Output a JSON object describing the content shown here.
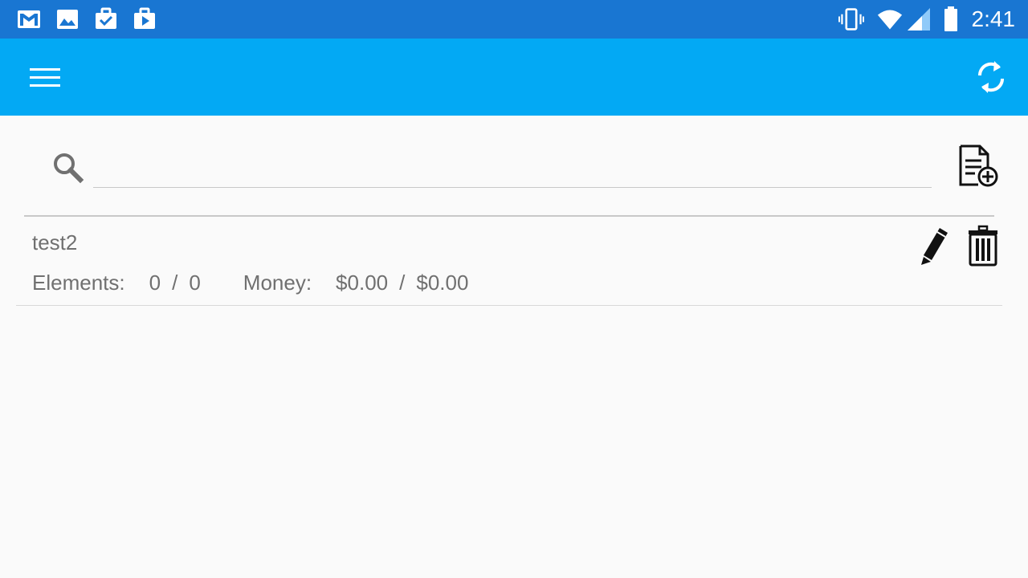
{
  "status_bar": {
    "time": "2:41",
    "left_icons": [
      "gmail-icon",
      "photos-icon",
      "task-done-icon",
      "play-store-icon"
    ],
    "right_icons": [
      "vibrate-icon",
      "wifi-icon",
      "cell-signal-icon",
      "battery-icon"
    ],
    "color": "#1976d2"
  },
  "app_bar": {
    "color": "#03a9f4",
    "menu_icon": "hamburger-menu-icon",
    "sync_icon": "sync-icon"
  },
  "search": {
    "value": "",
    "placeholder": "",
    "icon": "search-icon",
    "add_icon": "add-document-icon"
  },
  "items": [
    {
      "title": "test2",
      "elements_label": "Elements:",
      "elements_done": "0",
      "elements_sep": "/",
      "elements_total": "0",
      "money_label": "Money:",
      "money_spent": "$0.00",
      "money_sep": "/",
      "money_total": "$0.00",
      "edit_icon": "pencil-icon",
      "delete_icon": "trash-icon"
    }
  ]
}
